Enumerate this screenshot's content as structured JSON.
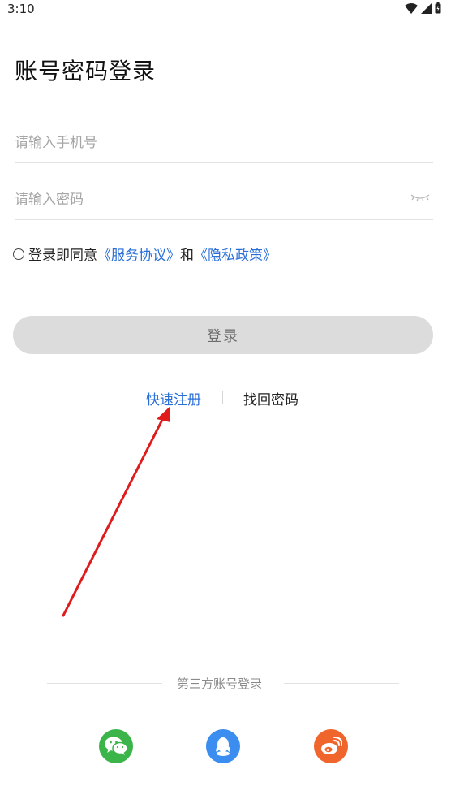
{
  "status_bar": {
    "time": "3:10"
  },
  "login": {
    "title": "账号密码登录",
    "phone_placeholder": "请输入手机号",
    "password_placeholder": "请输入密码",
    "agreement_prefix": "登录即同意",
    "service_link": "《服务协议》",
    "agreement_and": "和",
    "privacy_link": "《隐私政策》",
    "login_button": "登录",
    "quick_register": "快速注册",
    "find_password": "找回密码"
  },
  "third_party": {
    "label": "第三方账号登录",
    "providers": [
      "wechat",
      "qq",
      "weibo"
    ]
  },
  "colors": {
    "link": "#2a6fd8",
    "button_bg": "#dcdcdc",
    "wechat": "#3bb54a",
    "qq": "#3b8ef0",
    "weibo": "#f0652b",
    "annotation_arrow": "#e01b1b"
  }
}
